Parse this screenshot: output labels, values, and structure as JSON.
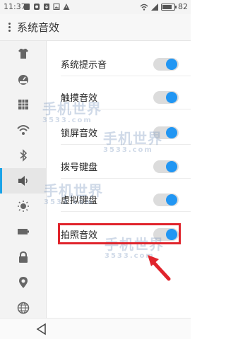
{
  "status_bar": {
    "time": "11:37",
    "battery_level": "82",
    "battery_fraction": 0.82
  },
  "header": {
    "title": "系统音效"
  },
  "sidebar": {
    "items": [
      {
        "icon": "shirt-icon"
      },
      {
        "icon": "dashboard-icon"
      },
      {
        "icon": "grid-icon"
      },
      {
        "icon": "wifi-icon"
      },
      {
        "icon": "bluetooth-icon"
      },
      {
        "icon": "speaker-icon",
        "active": true
      },
      {
        "icon": "brightness-icon"
      },
      {
        "icon": "battery-icon"
      },
      {
        "icon": "lock-icon"
      },
      {
        "icon": "location-icon"
      },
      {
        "icon": "globe-icon"
      }
    ]
  },
  "settings": {
    "items": [
      {
        "label": "系统提示音",
        "on": true
      },
      {
        "label": "触摸音效",
        "on": true
      },
      {
        "label": "锁屏音效",
        "on": true
      },
      {
        "label": "拨号键盘",
        "on": true
      },
      {
        "label": "虚拟键盘",
        "on": true
      },
      {
        "label": "拍照音效",
        "on": true
      }
    ]
  },
  "watermark": {
    "text": "手机世界",
    "sub": "3533.com"
  },
  "colors": {
    "accent": "#2196f3",
    "highlight": "#e0242c"
  }
}
